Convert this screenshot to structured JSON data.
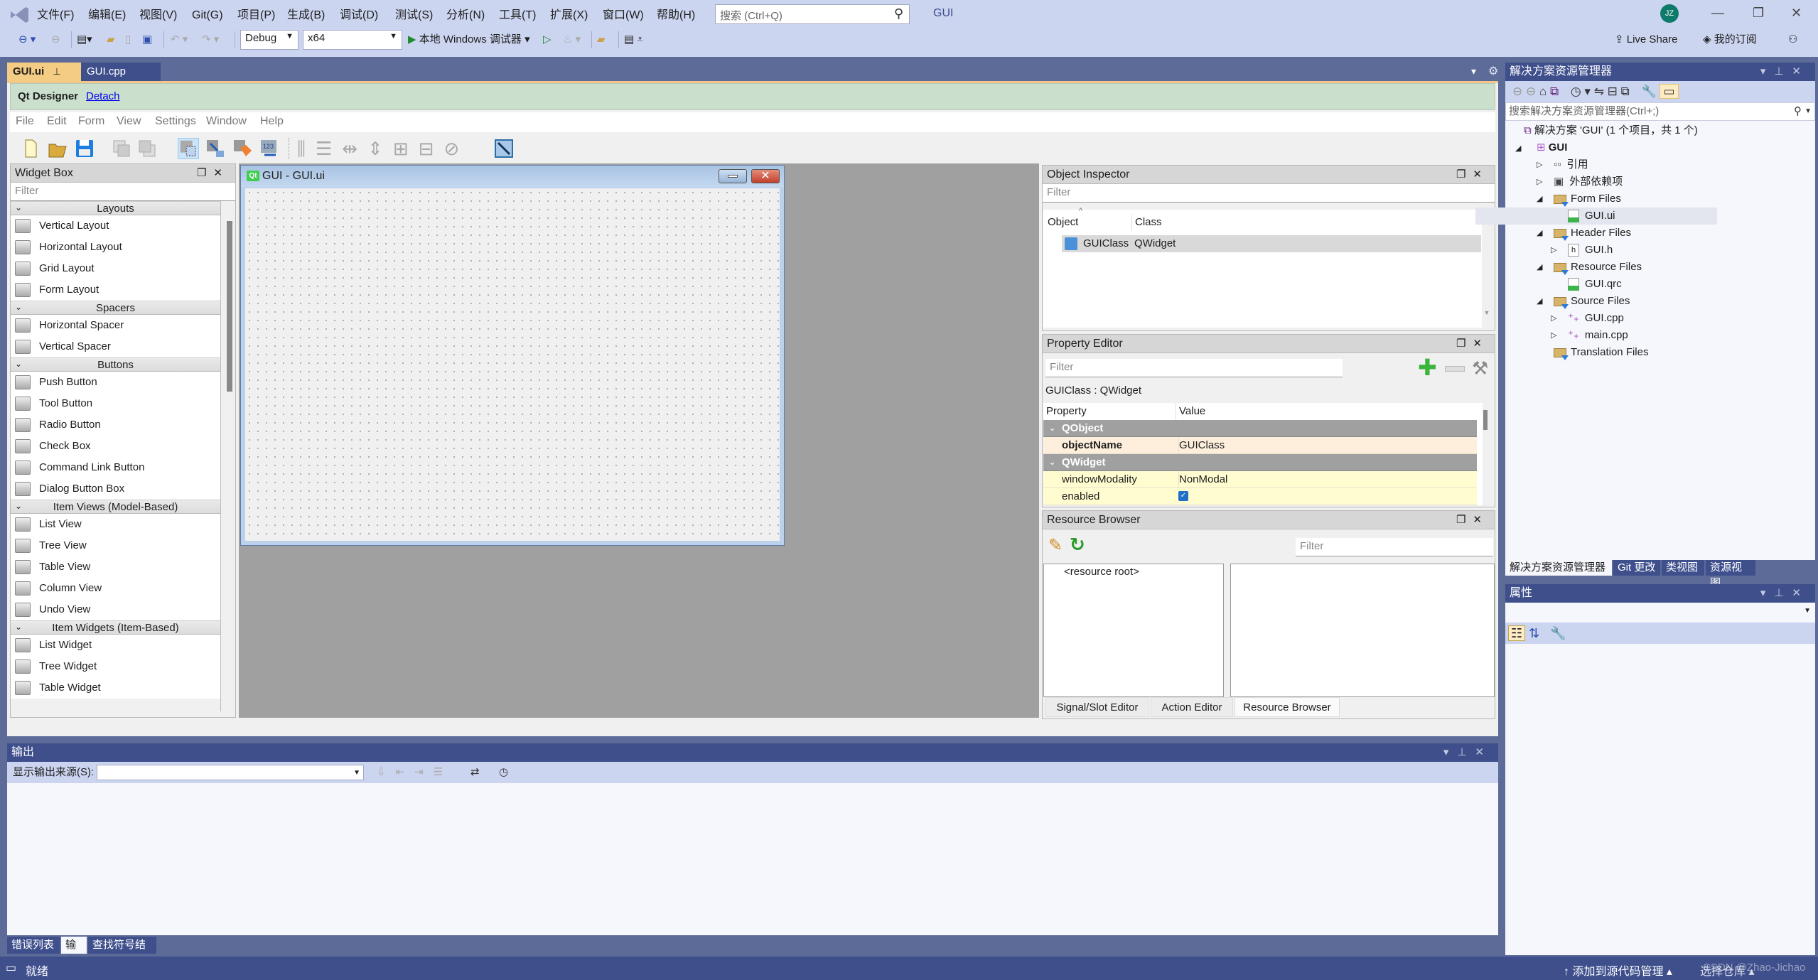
{
  "titlebar": {
    "menus": [
      "文件(F)",
      "编辑(E)",
      "视图(V)",
      "Git(G)",
      "项目(P)",
      "生成(B)",
      "调试(D)",
      "测试(S)",
      "分析(N)",
      "工具(T)",
      "扩展(X)",
      "窗口(W)",
      "帮助(H)"
    ],
    "search_placeholder": "搜索 (Ctrl+Q)",
    "solution_name": "GUI",
    "avatar_initials": "JZ",
    "config": "Debug",
    "platform": "x64",
    "run_label": "本地 Windows 调试器",
    "live_share": "Live Share",
    "subscription": "我的订阅"
  },
  "doc_tabs": [
    {
      "label": "GUI.ui",
      "active": true
    },
    {
      "label": "GUI.cpp",
      "active": false
    }
  ],
  "qt_designer": {
    "title": "Qt Designer",
    "detach": "Detach",
    "menus": [
      "File",
      "Edit",
      "Form",
      "View",
      "Settings",
      "Window",
      "Help"
    ]
  },
  "widget_box": {
    "title": "Widget Box",
    "filter_placeholder": "Filter",
    "categories": [
      {
        "name": "Layouts",
        "items": [
          "Vertical Layout",
          "Horizontal Layout",
          "Grid Layout",
          "Form Layout"
        ]
      },
      {
        "name": "Spacers",
        "items": [
          "Horizontal Spacer",
          "Vertical Spacer"
        ]
      },
      {
        "name": "Buttons",
        "items": [
          "Push Button",
          "Tool Button",
          "Radio Button",
          "Check Box",
          "Command Link Button",
          "Dialog Button Box"
        ]
      },
      {
        "name": "Item Views (Model-Based)",
        "items": [
          "List View",
          "Tree View",
          "Table View",
          "Column View",
          "Undo View"
        ]
      },
      {
        "name": "Item Widgets (Item-Based)",
        "items": [
          "List Widget",
          "Tree Widget",
          "Table Widget"
        ]
      }
    ]
  },
  "form_window": {
    "title": "GUI - GUI.ui",
    "icon_text": "Qt"
  },
  "object_inspector": {
    "title": "Object Inspector",
    "filter_placeholder": "Filter",
    "columns": [
      "Object",
      "Class"
    ],
    "rows": [
      {
        "object": "GUIClass",
        "class": "QWidget"
      }
    ]
  },
  "property_editor": {
    "title": "Property Editor",
    "filter_placeholder": "Filter",
    "context": "GUIClass : QWidget",
    "columns": [
      "Property",
      "Value"
    ],
    "rows": [
      {
        "type": "group",
        "name": "QObject"
      },
      {
        "type": "prop",
        "name": "objectName",
        "value": "GUIClass",
        "bold": true
      },
      {
        "type": "group",
        "name": "QWidget"
      },
      {
        "type": "prop",
        "name": "windowModality",
        "value": "NonModal"
      },
      {
        "type": "prop",
        "name": "enabled",
        "value": "checked"
      }
    ]
  },
  "resource_browser": {
    "title": "Resource Browser",
    "filter_placeholder": "Filter",
    "root": "<resource root>",
    "tabs": [
      "Signal/Slot Editor",
      "Action Editor",
      "Resource Browser"
    ],
    "active_tab": "Resource Browser"
  },
  "solution_explorer": {
    "title": "解决方案资源管理器",
    "search_placeholder": "搜索解决方案资源管理器(Ctrl+;)",
    "solution_label": "解决方案 'GUI' (1 个项目，共 1 个)",
    "project": "GUI",
    "nodes": [
      {
        "label": "引用",
        "level": 2,
        "expander": "collapsed",
        "icon": "reference-icon"
      },
      {
        "label": "外部依赖项",
        "level": 2,
        "expander": "collapsed",
        "icon": "external-deps-icon"
      },
      {
        "label": "Form Files",
        "level": 2,
        "expander": "expanded",
        "icon": "filter-folder-icon"
      },
      {
        "label": "GUI.ui",
        "level": 3,
        "expander": "none",
        "icon": "ui-file-icon",
        "selected": true
      },
      {
        "label": "Header Files",
        "level": 2,
        "expander": "expanded",
        "icon": "filter-folder-icon"
      },
      {
        "label": "GUI.h",
        "level": 3,
        "expander": "collapsed",
        "icon": "header-file-icon"
      },
      {
        "label": "Resource Files",
        "level": 2,
        "expander": "expanded",
        "icon": "filter-folder-icon"
      },
      {
        "label": "GUI.qrc",
        "level": 3,
        "expander": "none",
        "icon": "qrc-file-icon"
      },
      {
        "label": "Source Files",
        "level": 2,
        "expander": "expanded",
        "icon": "filter-folder-icon"
      },
      {
        "label": "GUI.cpp",
        "level": 3,
        "expander": "collapsed",
        "icon": "cpp-file-icon"
      },
      {
        "label": "main.cpp",
        "level": 3,
        "expander": "collapsed",
        "icon": "cpp-file-icon"
      },
      {
        "label": "Translation Files",
        "level": 2,
        "expander": "none",
        "icon": "filter-folder-icon"
      }
    ],
    "tabs": [
      "解决方案资源管理器",
      "Git 更改",
      "类视图",
      "资源视图"
    ],
    "active_tab": "解决方案资源管理器"
  },
  "properties_panel": {
    "title": "属性"
  },
  "output": {
    "title": "输出",
    "source_label": "显示输出来源(S):",
    "source_value": "",
    "tabs": [
      "错误列表",
      "输出",
      "查找符号结果"
    ],
    "active_tab": "输出"
  },
  "status": {
    "ready": "就绪",
    "add_source_control": "添加到源代码管理",
    "select_repo": "选择仓库",
    "watermark": "CSDN @Zhao-Jichao"
  }
}
